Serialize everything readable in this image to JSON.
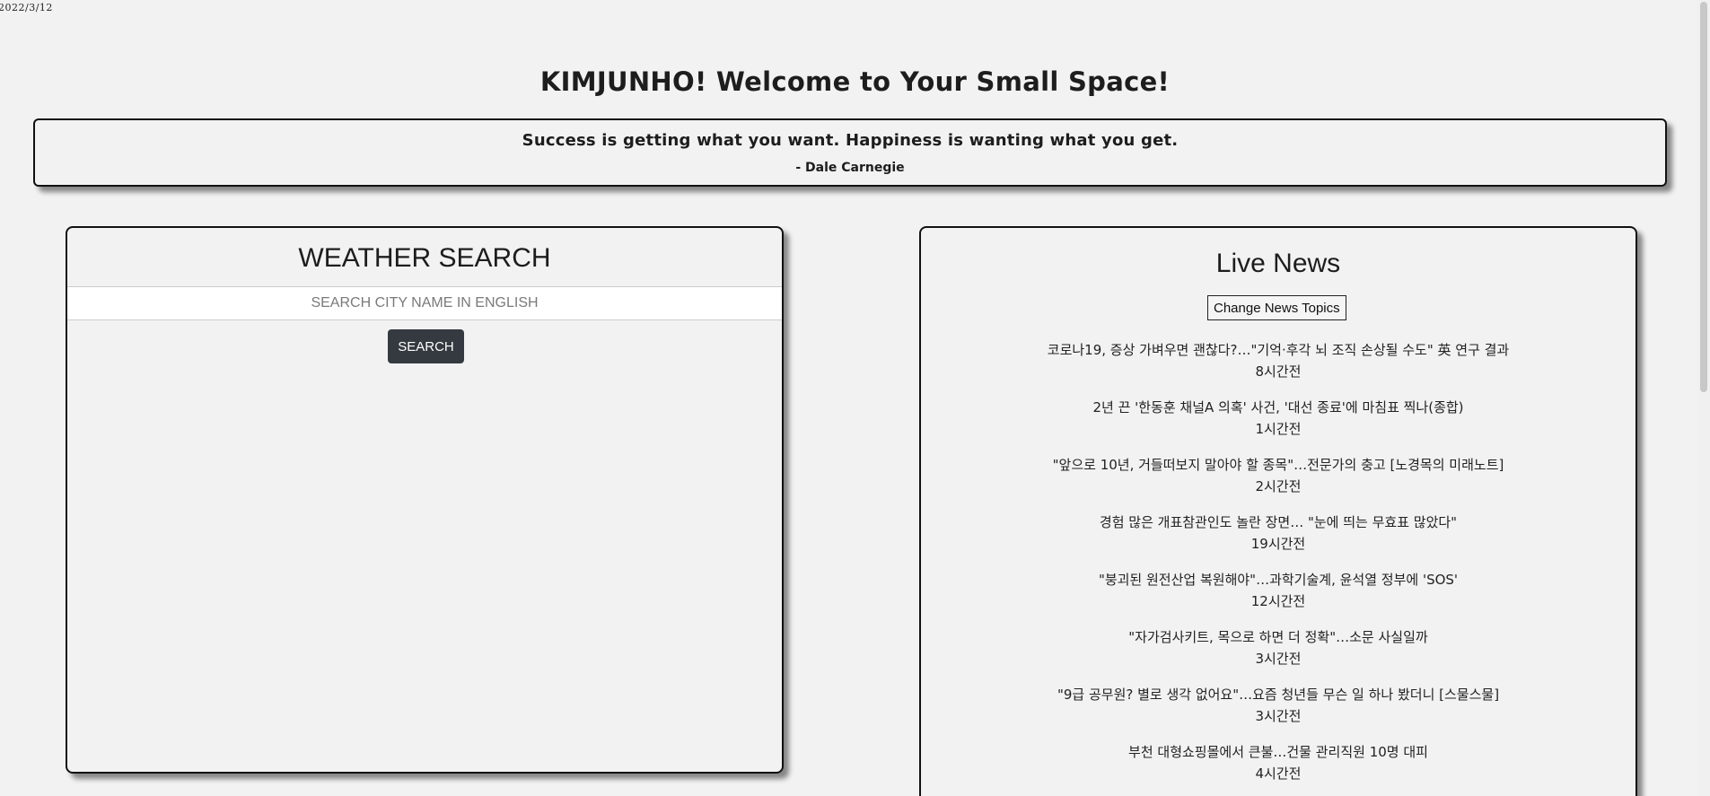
{
  "date": "2022/3/12",
  "header": {
    "title": "KIMJUNHO! Welcome to Your Small Space!"
  },
  "quote": {
    "text": "Success is getting what you want. Happiness is wanting what you get.",
    "author": "- Dale Carnegie"
  },
  "weather": {
    "title": "WEATHER SEARCH",
    "search_placeholder": "SEARCH CITY NAME IN ENGLISH",
    "search_value": "",
    "search_button": "SEARCH"
  },
  "news": {
    "title": "Live News",
    "topics_button": "Change News Topics",
    "items": [
      {
        "headline": "코로나19, 증상 가벼우면 괜찮다?…\"기억·후각 뇌 조직 손상될 수도\" 英 연구 결과",
        "time": "8시간전"
      },
      {
        "headline": "2년 끈 '한동훈 채널A 의혹' 사건, '대선 종료'에 마침표 찍나(종합)",
        "time": "1시간전"
      },
      {
        "headline": "\"앞으로 10년, 거들떠보지 말아야 할 종목\"…전문가의 충고 [노경목의 미래노트]",
        "time": "2시간전"
      },
      {
        "headline": "경험 많은 개표참관인도 놀란 장면… \"눈에 띄는 무효표 많았다\"",
        "time": "19시간전"
      },
      {
        "headline": "\"붕괴된 원전산업 복원해야\"…과학기술계, 윤석열 정부에 'SOS'",
        "time": "12시간전"
      },
      {
        "headline": "\"자가검사키트, 목으로 하면 더 정확\"…소문 사실일까",
        "time": "3시간전"
      },
      {
        "headline": "\"9급 공무원? 별로 생각 없어요\"…요즘 청년들 무슨 일 하나 봤더니 [스물스물]",
        "time": "3시간전"
      },
      {
        "headline": "부천 대형쇼핑몰에서 큰불…건물 관리직원 10명 대피",
        "time": "4시간전"
      }
    ]
  }
}
